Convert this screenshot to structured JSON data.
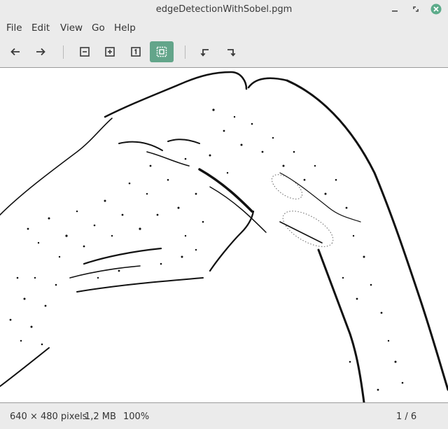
{
  "window": {
    "title": "edgeDetectionWithSobel.pgm",
    "controls": {
      "minimize": "minimize-icon",
      "maximize": "maximize-icon",
      "close": "close-icon"
    },
    "accent_color": "#63a58a",
    "close_color": "#5cab8a"
  },
  "menu": [
    "File",
    "Edit",
    "View",
    "Go",
    "Help"
  ],
  "toolbar": {
    "icons": [
      "arrow-left-icon",
      "arrow-right-icon",
      "zoom-out-icon",
      "zoom-in-icon",
      "zoom-normal-icon",
      "zoom-fit-icon",
      "rotate-left-icon",
      "rotate-right-icon"
    ],
    "active": "zoom-fit-icon"
  },
  "image": {
    "description_icon": "sobel-edge-image"
  },
  "status": {
    "dimensions": "640 × 480 pixels",
    "filesize": "1,2 MB",
    "zoom": "100%",
    "page": "1 / 6"
  }
}
